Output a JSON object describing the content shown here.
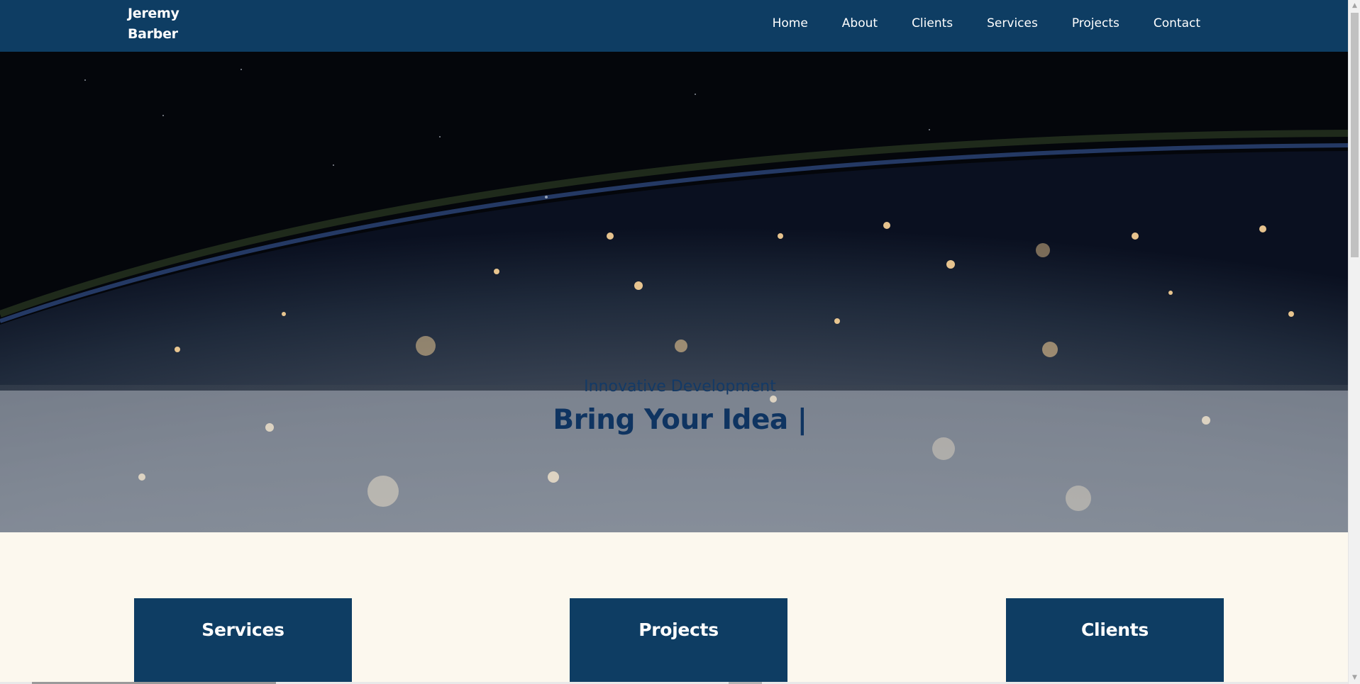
{
  "brand": {
    "line1": "Jeremy",
    "line2": "Barber"
  },
  "nav": {
    "items": [
      {
        "label": "Home"
      },
      {
        "label": "About"
      },
      {
        "label": "Clients"
      },
      {
        "label": "Services"
      },
      {
        "label": "Projects"
      },
      {
        "label": "Contact"
      }
    ]
  },
  "hero": {
    "subtitle": "Innovative Development",
    "title": "Bring Your Idea |",
    "background": "earth-at-night-image"
  },
  "cards": [
    {
      "label": "Services"
    },
    {
      "label": "Projects"
    },
    {
      "label": "Clients"
    }
  ],
  "colors": {
    "navbar": "#0e3d63",
    "page_background": "#fcf8ee",
    "hero_text": "#143a66",
    "card": "#0e3d63"
  }
}
